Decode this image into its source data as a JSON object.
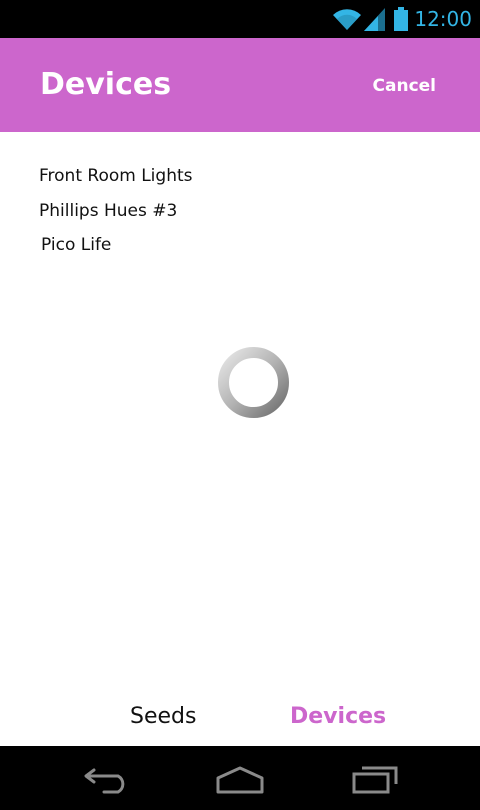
{
  "status_bar": {
    "time": "12:00",
    "icons": [
      "wifi-icon",
      "signal-icon",
      "battery-icon"
    ],
    "icon_color": "#33b5e5"
  },
  "action_bar": {
    "title": "Devices",
    "cancel_label": "Cancel",
    "background": "#cc66cc"
  },
  "devices": [
    {
      "name": "Front Room Lights"
    },
    {
      "name": "Phillips Hues #3"
    },
    {
      "name": "Pico Life"
    }
  ],
  "loading": {
    "icon": "loading-spinner-icon"
  },
  "tabs": [
    {
      "label": "Seeds",
      "active": false
    },
    {
      "label": "Devices",
      "active": true
    }
  ],
  "nav_bar": {
    "buttons": [
      "back-icon",
      "home-icon",
      "recent-apps-icon"
    ]
  },
  "colors": {
    "accent": "#cc66cc",
    "status_icon": "#33b5e5",
    "system_bar": "#000000"
  }
}
